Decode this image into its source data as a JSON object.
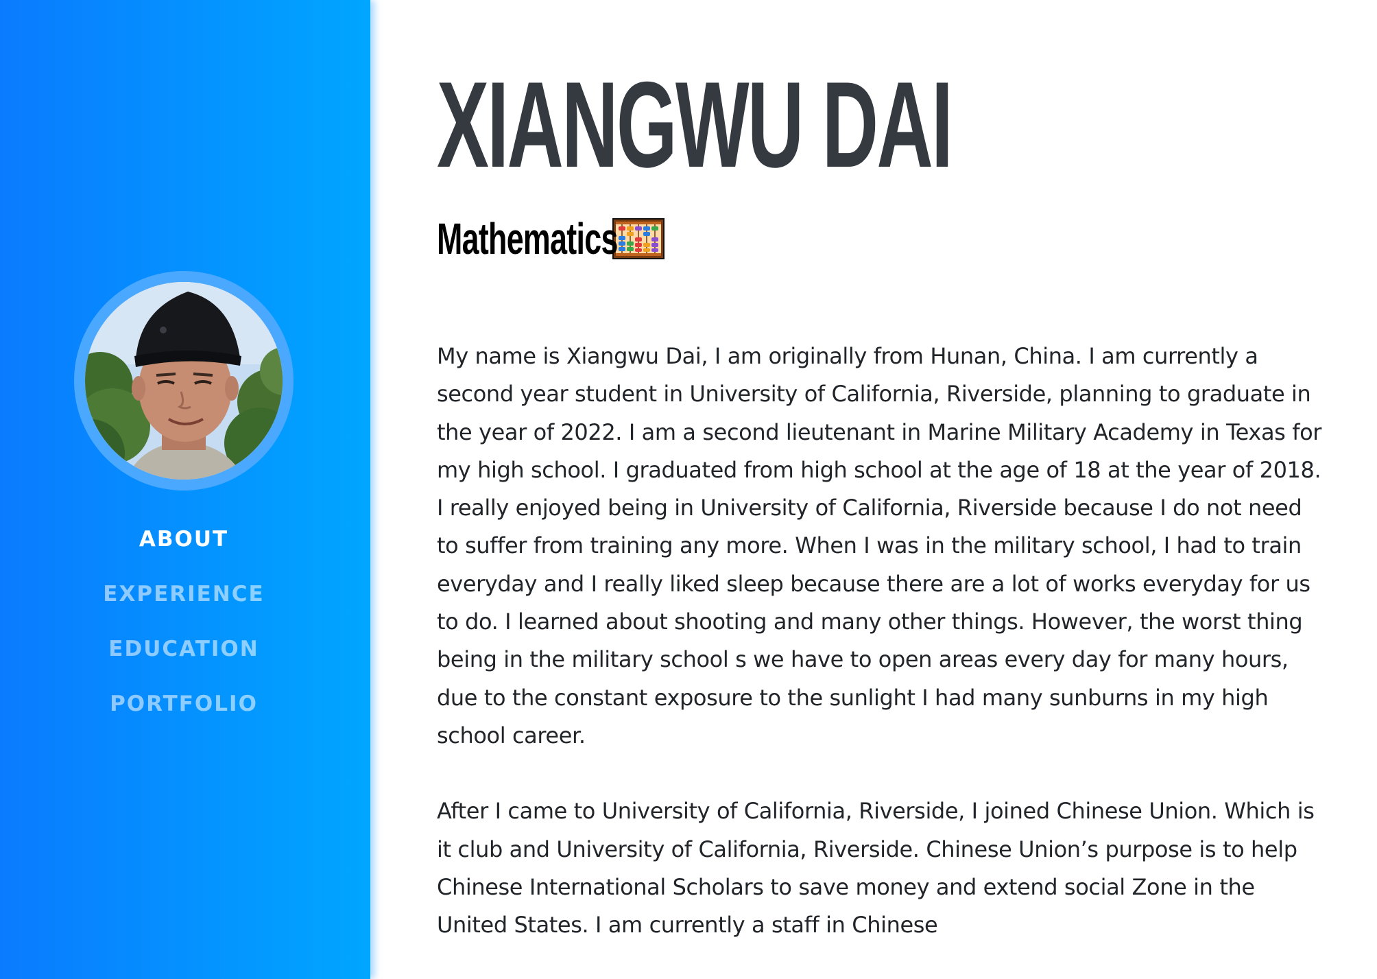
{
  "sidebar": {
    "avatar_alt": "Profile photo",
    "nav": [
      {
        "label": "ABOUT",
        "active": true
      },
      {
        "label": "EXPERIENCE",
        "active": false
      },
      {
        "label": "EDUCATION",
        "active": false
      },
      {
        "label": "PORTFOLIO",
        "active": false
      }
    ],
    "gradient_colors": [
      "#0a7bff",
      "#00a6ff"
    ]
  },
  "main": {
    "name": "XIANGWU DAI",
    "subtitle": "Mathematics",
    "subtitle_icon": "abacus-icon",
    "paragraphs": [
      "My name is Xiangwu Dai, I am originally from Hunan, China. I am currently a second year student in University of California, Riverside, planning to graduate in the year of 2022. I am a second lieutenant in Marine Military Academy in Texas for my high school. I graduated from high school at the age of 18 at the year of 2018. I really enjoyed being in University of California, Riverside because I do not need to suffer from training any more. When I was in the military school, I had to train everyday and I really liked sleep because there are a lot of works everyday for us to do. I learned about shooting and many other things. However, the worst thing being in the military school s we have to open areas every day for many hours, due to the constant exposure to the sunlight I had many sunburns in my high school career.",
      "After I came to University of California, Riverside, I joined Chinese Union. Which is it club and University of California, Riverside. Chinese Union’s purpose is to help Chinese International Scholars to save money and extend social Zone in the United States. I am currently a staff in Chinese"
    ]
  }
}
